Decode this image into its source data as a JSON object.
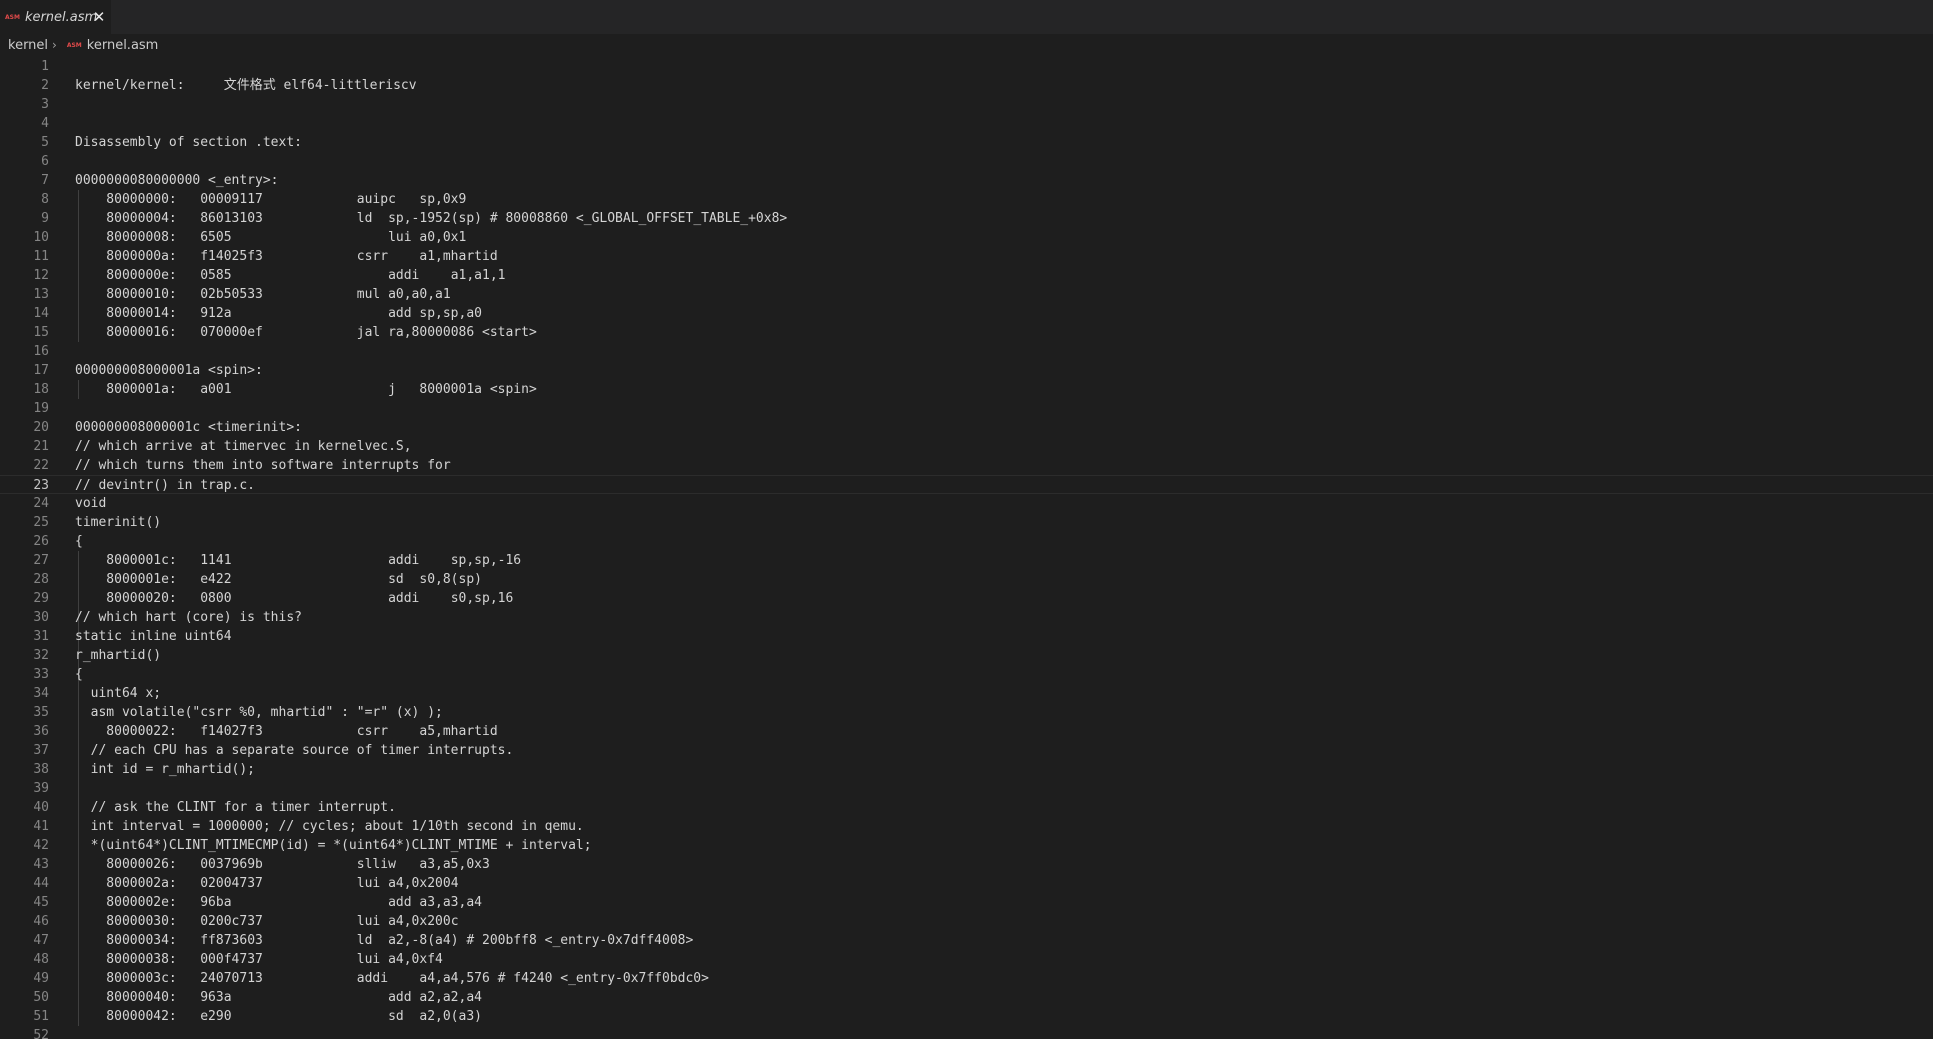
{
  "tab": {
    "icon": "ASM",
    "label": "kernel.asm",
    "close_icon": "close-icon"
  },
  "breadcrumb": {
    "folder": "kernel",
    "separator": "›",
    "file_icon": "ASM",
    "file": "kernel.asm"
  },
  "editor": {
    "current_line": 23,
    "lines": [
      {
        "n": "1",
        "text": ""
      },
      {
        "n": "2",
        "text": "kernel/kernel:     文件格式 elf64-littleriscv"
      },
      {
        "n": "3",
        "text": ""
      },
      {
        "n": "4",
        "text": ""
      },
      {
        "n": "5",
        "text": "Disassembly of section .text:"
      },
      {
        "n": "6",
        "text": ""
      },
      {
        "n": "7",
        "text": "0000000080000000 <_entry>:"
      },
      {
        "n": "8",
        "text": "    80000000:\t00009117          \tauipc\tsp,0x9"
      },
      {
        "n": "9",
        "text": "    80000004:\t86013103          \tld\tsp,-1952(sp) # 80008860 <_GLOBAL_OFFSET_TABLE_+0x8>"
      },
      {
        "n": "10",
        "text": "    80000008:\t6505                \tlui\ta0,0x1"
      },
      {
        "n": "11",
        "text": "    8000000a:\tf14025f3          \tcsrr\ta1,mhartid"
      },
      {
        "n": "12",
        "text": "    8000000e:\t0585                \taddi\ta1,a1,1"
      },
      {
        "n": "13",
        "text": "    80000010:\t02b50533          \tmul\ta0,a0,a1"
      },
      {
        "n": "14",
        "text": "    80000014:\t912a                \tadd\tsp,sp,a0"
      },
      {
        "n": "15",
        "text": "    80000016:\t070000ef          \tjal\tra,80000086 <start>"
      },
      {
        "n": "16",
        "text": ""
      },
      {
        "n": "17",
        "text": "000000008000001a <spin>:"
      },
      {
        "n": "18",
        "text": "    8000001a:\ta001                \tj\t8000001a <spin>"
      },
      {
        "n": "19",
        "text": ""
      },
      {
        "n": "20",
        "text": "000000008000001c <timerinit>:"
      },
      {
        "n": "21",
        "text": "// which arrive at timervec in kernelvec.S,"
      },
      {
        "n": "22",
        "text": "// which turns them into software interrupts for"
      },
      {
        "n": "23",
        "text": "// devintr() in trap.c."
      },
      {
        "n": "24",
        "text": "void"
      },
      {
        "n": "25",
        "text": "timerinit()"
      },
      {
        "n": "26",
        "text": "{"
      },
      {
        "n": "27",
        "text": "    8000001c:\t1141                \taddi\tsp,sp,-16"
      },
      {
        "n": "28",
        "text": "    8000001e:\te422                \tsd\ts0,8(sp)"
      },
      {
        "n": "29",
        "text": "    80000020:\t0800                \taddi\ts0,sp,16"
      },
      {
        "n": "30",
        "text": "// which hart (core) is this?"
      },
      {
        "n": "31",
        "text": "static inline uint64"
      },
      {
        "n": "32",
        "text": "r_mhartid()"
      },
      {
        "n": "33",
        "text": "{"
      },
      {
        "n": "34",
        "text": "  uint64 x;"
      },
      {
        "n": "35",
        "text": "  asm volatile(\"csrr %0, mhartid\" : \"=r\" (x) );"
      },
      {
        "n": "36",
        "text": "    80000022:\tf14027f3          \tcsrr\ta5,mhartid"
      },
      {
        "n": "37",
        "text": "  // each CPU has a separate source of timer interrupts."
      },
      {
        "n": "38",
        "text": "  int id = r_mhartid();"
      },
      {
        "n": "39",
        "text": ""
      },
      {
        "n": "40",
        "text": "  // ask the CLINT for a timer interrupt."
      },
      {
        "n": "41",
        "text": "  int interval = 1000000; // cycles; about 1/10th second in qemu."
      },
      {
        "n": "42",
        "text": "  *(uint64*)CLINT_MTIMECMP(id) = *(uint64*)CLINT_MTIME + interval;"
      },
      {
        "n": "43",
        "text": "    80000026:\t0037969b          \tslliw\ta3,a5,0x3"
      },
      {
        "n": "44",
        "text": "    8000002a:\t02004737          \tlui\ta4,0x2004"
      },
      {
        "n": "45",
        "text": "    8000002e:\t96ba                \tadd\ta3,a3,a4"
      },
      {
        "n": "46",
        "text": "    80000030:\t0200c737          \tlui\ta4,0x200c"
      },
      {
        "n": "47",
        "text": "    80000034:\tff873603          \tld\ta2,-8(a4) # 200bff8 <_entry-0x7dff4008>"
      },
      {
        "n": "48",
        "text": "    80000038:\t000f4737          \tlui\ta4,0xf4"
      },
      {
        "n": "49",
        "text": "    8000003c:\t24070713          \taddi\ta4,a4,576 # f4240 <_entry-0x7ff0bdc0>"
      },
      {
        "n": "50",
        "text": "    80000040:\t963a                \tadd\ta2,a2,a4"
      },
      {
        "n": "51",
        "text": "    80000042:\te290                \tsd\ta2,0(a3)"
      },
      {
        "n": "52",
        "text": ""
      }
    ]
  }
}
